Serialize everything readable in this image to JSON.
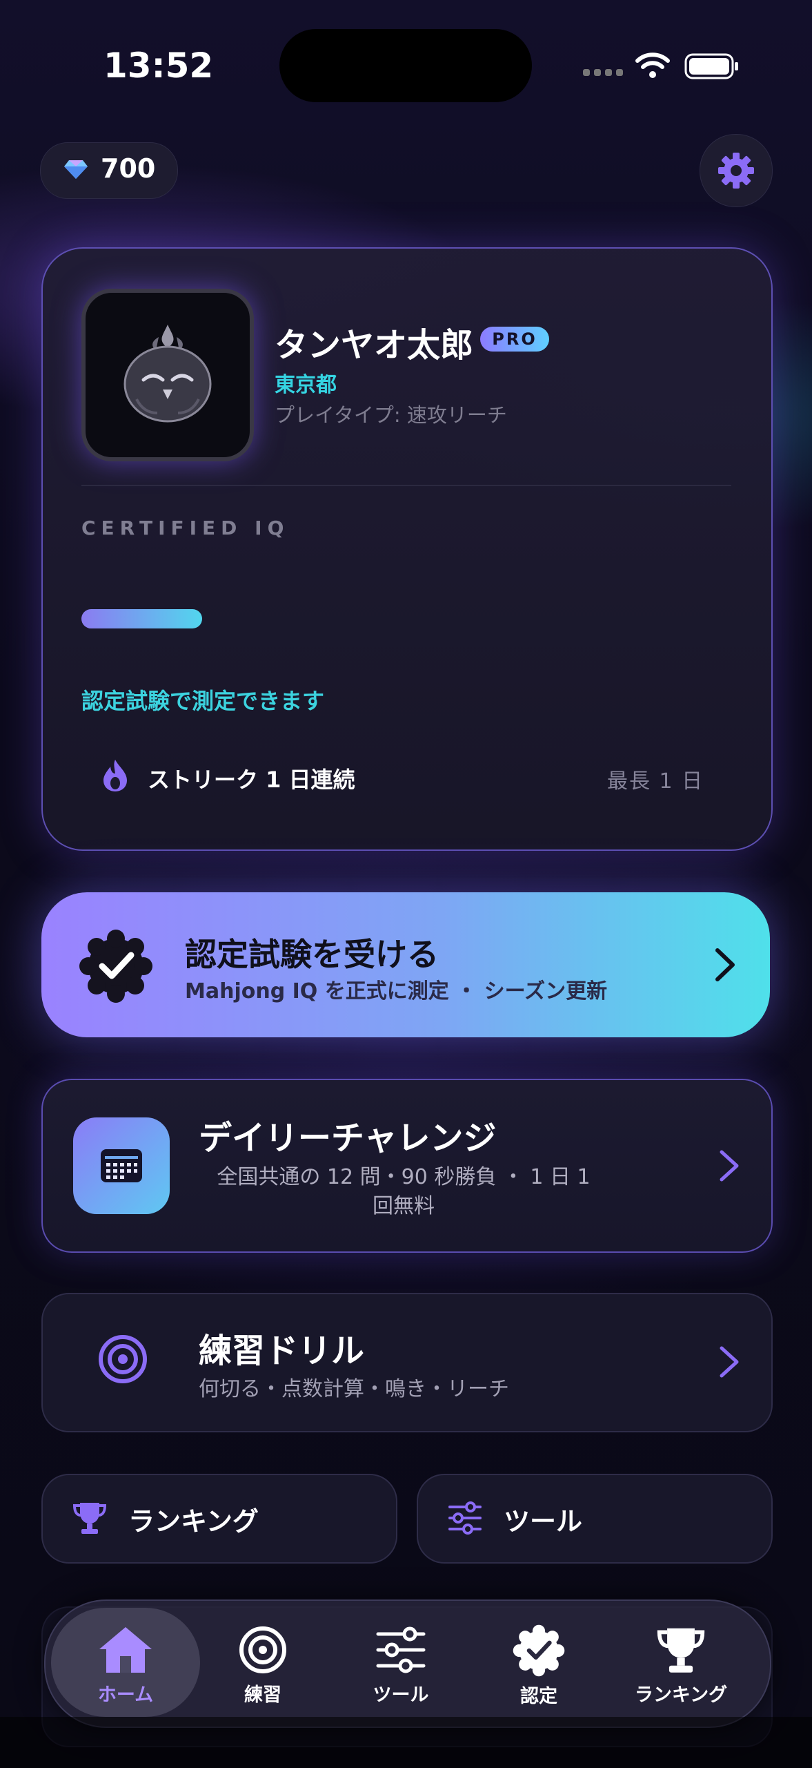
{
  "status_bar": {
    "time": "13:52"
  },
  "header": {
    "gem_count": "700",
    "gem_icon": "gem-icon",
    "settings_icon": "gear-icon"
  },
  "profile": {
    "name": "タンヤオ太郎",
    "badge": "PRO",
    "prefecture": "東京都",
    "play_type": "プレイタイプ: 速攻リーチ",
    "certified_iq_label": "CERTIFIED IQ",
    "certification_note": "認定試験で測定できます",
    "streak": "ストリーク 1 日連続",
    "best_streak": "最長  1  日"
  },
  "certification_cta": {
    "title": "認定試験を受ける",
    "subtitle": "Mahjong IQ を正式に測定 ・ シーズン更新"
  },
  "daily_challenge": {
    "title": "デイリーチャレンジ",
    "subtitle_line1": "全国共通の 12 問・90 秒勝負 ・ 1 日 1",
    "subtitle_line2": "回無料"
  },
  "drill": {
    "title": "練習ドリル",
    "subtitle": "何切る・点数計算・鳴き・リーチ"
  },
  "quick_links": {
    "ranking": "ランキング",
    "tools": "ツール"
  },
  "tab_bar": {
    "active": "home",
    "tabs": [
      {
        "id": "home",
        "label": "ホーム",
        "icon": "home-icon"
      },
      {
        "id": "practice",
        "label": "練習",
        "icon": "target-icon"
      },
      {
        "id": "tools",
        "label": "ツール",
        "icon": "sliders-icon"
      },
      {
        "id": "certification",
        "label": "認定",
        "icon": "verified-badge-icon"
      },
      {
        "id": "ranking",
        "label": "ランキング",
        "icon": "trophy-icon"
      }
    ]
  },
  "colors": {
    "accent_purple": "#8b7bf0",
    "accent_cyan": "#3cd3df",
    "background": "#0b0a18"
  }
}
